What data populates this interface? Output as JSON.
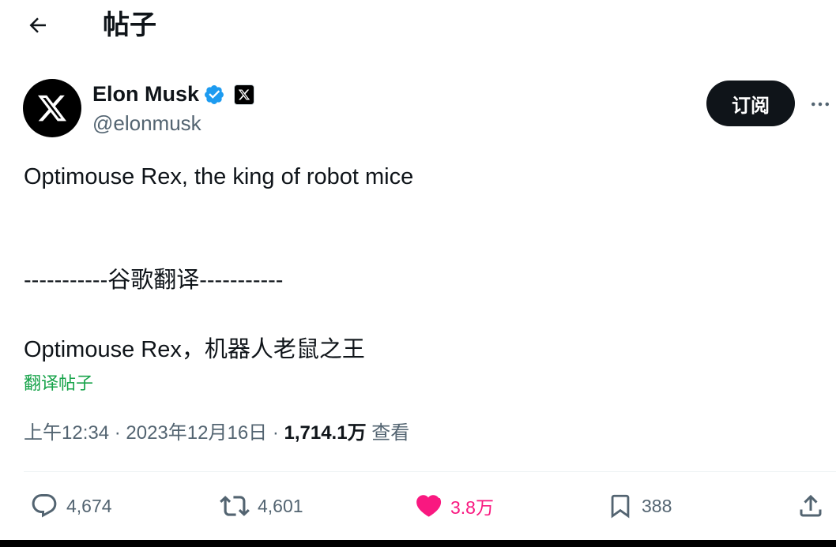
{
  "header": {
    "title": "帖子",
    "back_icon": "arrow-left-icon"
  },
  "author": {
    "name": "Elon Musk",
    "handle": "@elonmusk",
    "verified_color": "#1d9bf0",
    "avatar_icon": "x-logo-icon",
    "affiliation_icon": "x-logo-icon"
  },
  "subscribe_label": "订阅",
  "more_icon": "more-dots-icon",
  "tweet": {
    "text": "Optimouse Rex, the king of robot mice",
    "separator": "-----------谷歌翻译-----------",
    "translation": "Optimouse Rex，机器人老鼠之王"
  },
  "translate_link": "翻译帖子",
  "meta": {
    "time": "上午12:34",
    "dot": " · ",
    "date": "2023年12月16日",
    "views": "1,714.1万",
    "views_label": " 查看"
  },
  "actions": {
    "replies": "4,674",
    "retweets": "4,601",
    "likes": "3.8万",
    "bookmarks": "388"
  },
  "colors": {
    "like": "#f91880",
    "link": "#17a34a",
    "muted": "#536471"
  }
}
